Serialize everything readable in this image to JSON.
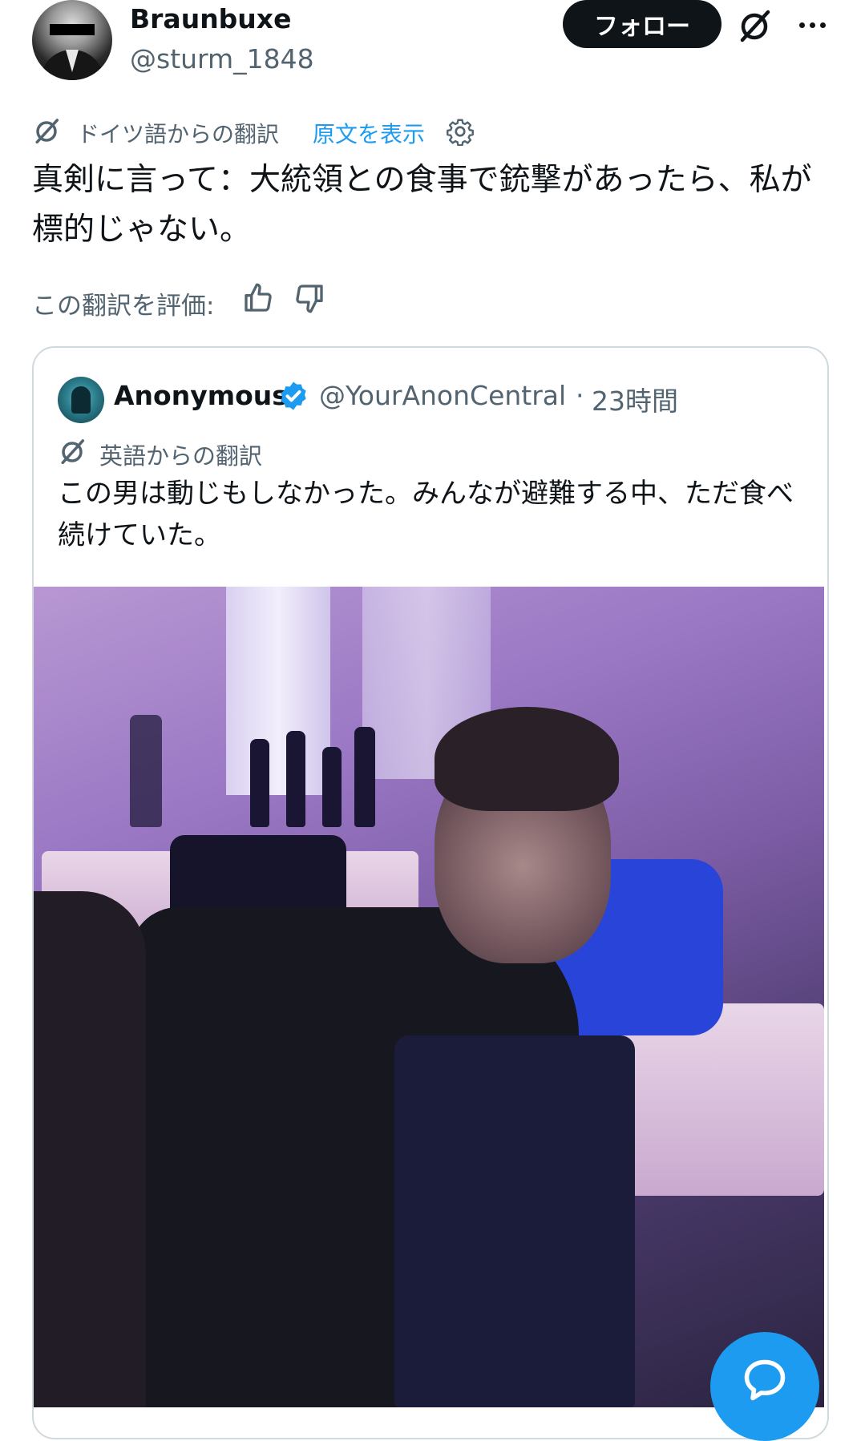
{
  "author": {
    "name": "Braunbuxe",
    "handle": "@sturm_1848",
    "avatar_icon": "avatar-masked-person"
  },
  "header": {
    "follow_label": "フォロー",
    "grok_icon": "grok-icon",
    "more_icon": "more-icon"
  },
  "translation": {
    "label": "ドイツ語からの翻訳",
    "show_original": "原文を表示",
    "settings_icon": "gear-icon"
  },
  "tweet": {
    "text": "真剣に言って：大統領との食事で銃撃があったら、私が標的じゃない。"
  },
  "rating": {
    "label": "この翻訳を評価:",
    "up_icon": "thumbs-up-icon",
    "down_icon": "thumbs-down-icon"
  },
  "quote": {
    "name": "Anonymous",
    "verified": true,
    "handle": "@YourAnonCentral",
    "separator": "·",
    "time": "23時間",
    "translation_label": "英語からの翻訳",
    "text": "この男は動じもしなかった。みんなが避難する中、ただ食べ続けていた。"
  },
  "fab": {
    "icon": "reply-bubble-icon"
  },
  "colors": {
    "accent": "#1d9bf0",
    "text": "#0f1419",
    "muted": "#536471",
    "border": "#cfd9de"
  }
}
